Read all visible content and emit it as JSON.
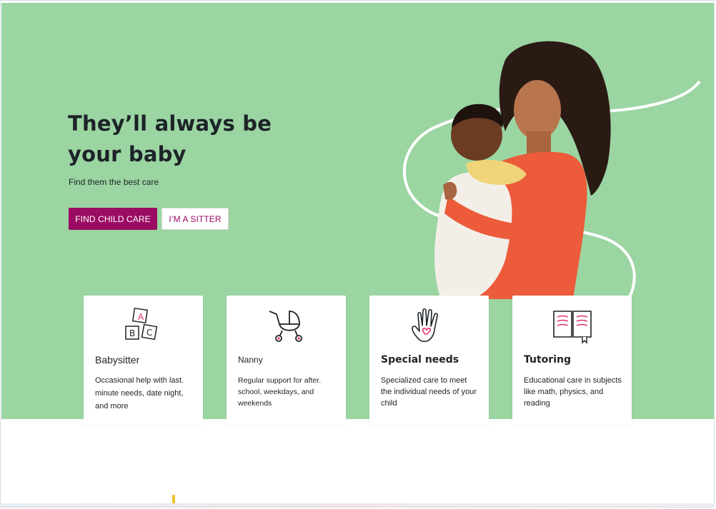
{
  "hero": {
    "headline": "They’ll always be your baby",
    "subhead": "Find them the best care",
    "primary_button": "FIND CHILD CARE",
    "secondary_button": "I’M A SITTER"
  },
  "cards": [
    {
      "title": "Babysitter",
      "description": "Occasional help with last. minute needs, date night, and more",
      "icon": "abc-blocks-icon"
    },
    {
      "title": "Nanny",
      "description": "Regular support for after. school, weekdays, and weekends",
      "icon": "stroller-icon"
    },
    {
      "title": "Special needs",
      "description": "Specialized care to meet the individual needs of your child",
      "icon": "hand-heart-icon"
    },
    {
      "title": "Tutoring",
      "description": "Educational care in subjects like math, physics, and reading",
      "icon": "open-book-icon"
    }
  ],
  "colors": {
    "hero_background": "#9bd5a2",
    "brand_primary": "#9b0b63",
    "accent_pink": "#e0306f",
    "text_dark": "#1d2328"
  }
}
